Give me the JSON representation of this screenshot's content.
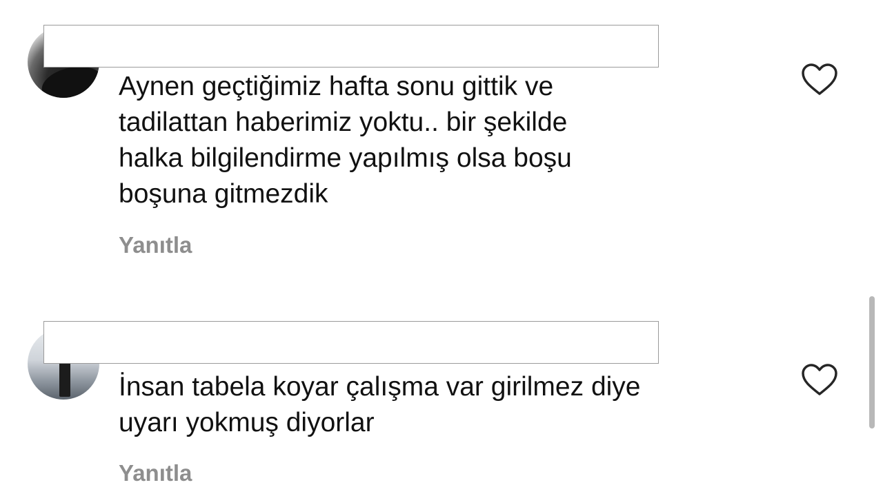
{
  "comments": [
    {
      "username": "",
      "text_lines": [
        "Aynen geçtiğimiz hafta sonu gittik ve",
        "tadilattan haberimiz yoktu.. bir şekilde",
        "halka bilgilendirme yapılmış olsa boşu",
        "boşuna gitmezdik"
      ],
      "reply_label": "Yanıtla",
      "like_icon": "heart-outline-icon"
    },
    {
      "username": "",
      "text_lines": [
        "İnsan tabela koyar çalışma var girilmez diye",
        "uyarı yokmuş diyorlar"
      ],
      "reply_label": "Yanıtla",
      "like_icon": "heart-outline-icon"
    }
  ],
  "colors": {
    "background": "#ffffff",
    "text": "#111111",
    "secondary_text": "#8e8e8e",
    "redaction_border": "#9a9a9a",
    "scrollbar": "#b8b8b8"
  }
}
